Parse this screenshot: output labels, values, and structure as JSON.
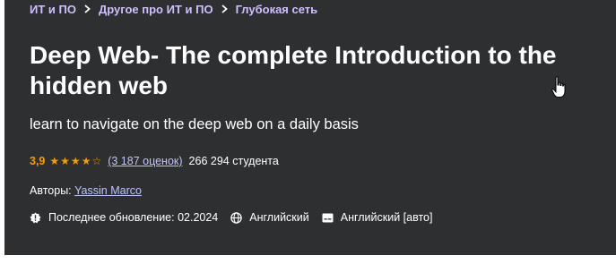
{
  "breadcrumb": [
    {
      "label": "ИТ и ПО"
    },
    {
      "label": "Другое про ИТ и ПО"
    },
    {
      "label": "Глубокая сеть"
    }
  ],
  "course": {
    "title": "Deep Web- The complete Introduction to the hidden web",
    "subtitle": "learn to navigate on the deep web on a daily basis",
    "rating": "3,9",
    "rating_fraction": 0.78,
    "ratings_count": "(3 187 оценок)",
    "students": "266 294 студента",
    "authors_label": "Авторы:",
    "author": "Yassin Marco",
    "last_updated": "Последнее обновление: 02.2024",
    "language": "Английский",
    "captions": "Английский [авто]"
  },
  "icons": {
    "breadcrumb_separator": "chevron-right-icon",
    "updated": "alert-badge-icon",
    "language": "globe-icon",
    "captions": "closed-captions-icon",
    "cursor": "hand-pointer-icon"
  },
  "colors": {
    "banner_bg": "#2d2f31",
    "link": "#c0c4fc",
    "rating": "#f69c08"
  }
}
